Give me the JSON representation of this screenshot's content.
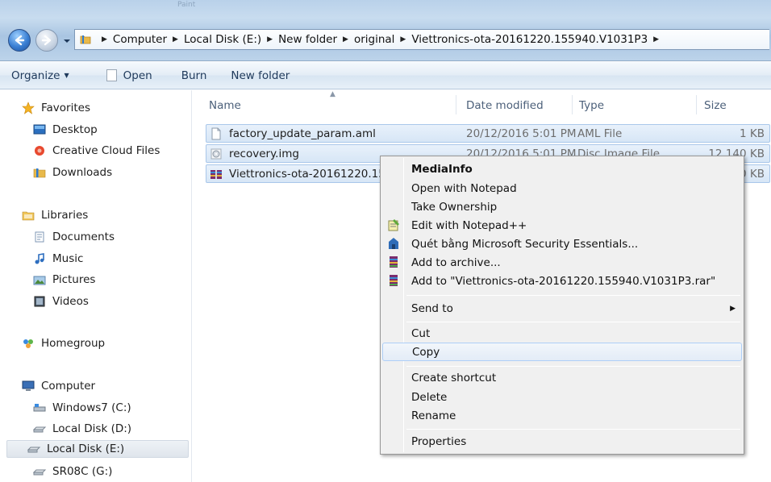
{
  "window": {
    "title_ghost": "Paint"
  },
  "address": {
    "crumbs": [
      "Computer",
      "Local Disk (E:)",
      "New folder",
      "original",
      "Viettronics-ota-20161220.155940.V1031P3"
    ]
  },
  "toolbar": {
    "organize": "Organize",
    "open": "Open",
    "burn": "Burn",
    "new_folder": "New folder"
  },
  "nav": {
    "favorites": "Favorites",
    "desktop": "Desktop",
    "creative_cloud": "Creative Cloud Files",
    "downloads": "Downloads",
    "libraries": "Libraries",
    "documents": "Documents",
    "music": "Music",
    "pictures": "Pictures",
    "videos": "Videos",
    "homegroup": "Homegroup",
    "computer": "Computer",
    "drive_c": "Windows7 (C:)",
    "drive_d": "Local Disk (D:)",
    "drive_e": "Local Disk (E:)",
    "drive_g": "SR08C (G:)"
  },
  "columns": {
    "name": "Name",
    "date": "Date modified",
    "type": "Type",
    "size": "Size"
  },
  "files": [
    {
      "name": "factory_update_param.aml",
      "date": "20/12/2016 5:01 PM",
      "type": "AML File",
      "size": "1 KB",
      "icon": "document-icon"
    },
    {
      "name": "recovery.img",
      "date": "20/12/2016 5:01 PM",
      "type": "Disc Image File",
      "size": "12,140 KB",
      "icon": "disc-image-icon"
    },
    {
      "name": "Viettronics-ota-20161220.15",
      "date": "",
      "type": "",
      "size": "90 KB",
      "icon": "rar-archive-icon"
    }
  ],
  "context_menu": {
    "mediainfo": "MediaInfo",
    "open_notepad": "Open with Notepad",
    "take_ownership": "Take Ownership",
    "edit_notepadpp": "Edit with Notepad++",
    "scan_mse": "Quét bằng Microsoft Security Essentials...",
    "add_archive": "Add to archive...",
    "add_rar": "Add to \"Viettronics-ota-20161220.155940.V1031P3.rar\"",
    "send_to": "Send to",
    "cut": "Cut",
    "copy": "Copy",
    "create_shortcut": "Create shortcut",
    "delete": "Delete",
    "rename": "Rename",
    "properties": "Properties"
  },
  "colors": {
    "selection_fill": "#d7e6f6",
    "selection_border": "#a9c7ea",
    "menu_bg": "#f0f0f0",
    "menu_highlight_border": "#aecff7"
  }
}
